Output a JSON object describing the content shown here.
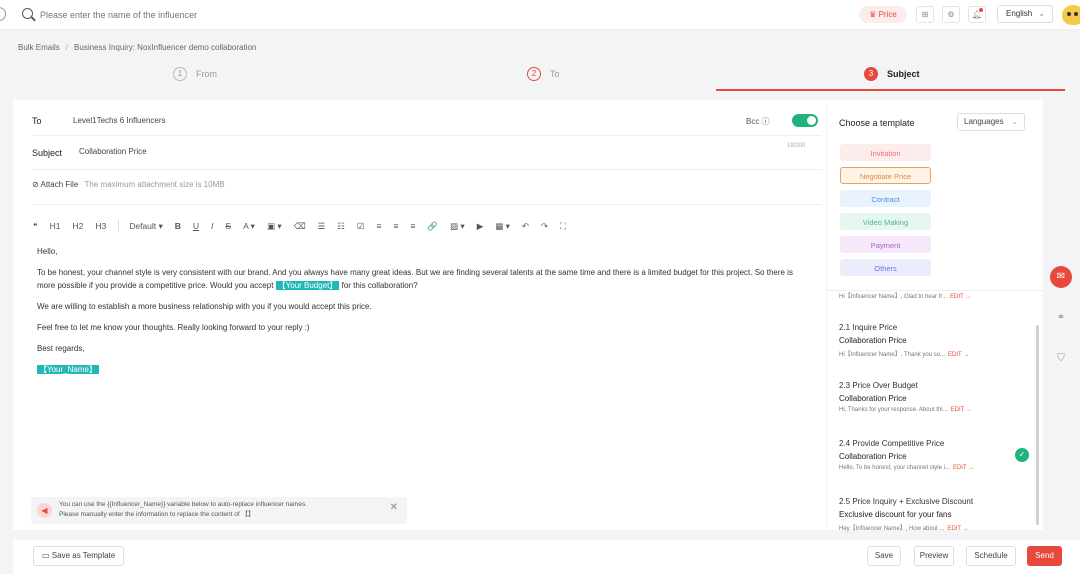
{
  "topbar": {
    "search_placeholder": "Please enter the name of the influencer",
    "price_label": "♛ Price",
    "language": "English"
  },
  "breadcrumb": {
    "root": "Bulk Emails",
    "current": "Business Inquiry: NoxInfluencer demo collaboration"
  },
  "steps": [
    {
      "num": "1",
      "label": "From"
    },
    {
      "num": "2",
      "label": "To"
    },
    {
      "num": "3",
      "label": "Subject"
    }
  ],
  "form": {
    "to_label": "To",
    "to_value": "Level1Techs 6 Influencers",
    "bcc_label": "Bcc ⓘ",
    "subject_label": "Subject",
    "subject_value": "Collaboration Price",
    "subject_counter": "19/200",
    "attach_label": "Attach File",
    "attach_hint": "The maximum attachment size is 10MB"
  },
  "toolbar": {
    "quote": "❝",
    "h1": "H1",
    "h2": "H2",
    "h3": "H3",
    "font": "Default ▾",
    "bold": "B",
    "underline": "U",
    "italic": "I",
    "strike": "S",
    "color": "A ▾",
    "bg": "▣ ▾",
    "eraser": "⌫",
    "ul": "☰",
    "ol": "☷",
    "task": "☑",
    "align_left": "≡",
    "align_center": "≡",
    "align_right": "≡",
    "link": "🔗",
    "image": "▨ ▾",
    "video": "▶",
    "table": "▦ ▾",
    "undo": "↶",
    "redo": "↷",
    "fullscreen": "⛶"
  },
  "body": {
    "greeting": "Hello,",
    "p1_a": "To be honest, your channel style is very consistent with our brand. And you always have many great ideas. But we are finding several talents at the same time and there is a limited budget for this project. So there is more possible if you provide a competitive price. Would you accept ",
    "p1_tag": "【Your Budget】",
    "p1_b": " for this collaboration?",
    "p2": "We are willing to establish a more business relationship with you if you would accept this price.",
    "p3": "Feel free to let me know your thoughts. Really looking forward to your reply :)",
    "p4": "Best regards,",
    "signature_tag": "【Your_Name】"
  },
  "hint": {
    "line1": "You can use the {{Influencer_Name}} variable below to auto-replace influencer names.",
    "line2": "Please manually enter the information to replace the content of 【】"
  },
  "template_panel": {
    "title": "Choose a template",
    "languages": "Languages",
    "categories": [
      {
        "label": "Invitation",
        "bg": "#fdecec",
        "color": "#e57373",
        "border": "#fdecec"
      },
      {
        "label": "Negotiate Price",
        "bg": "#fef3e6",
        "color": "#e08a3c",
        "border": "#e8a25c"
      },
      {
        "label": "Contract",
        "bg": "#e8f3fd",
        "color": "#4a90d9",
        "border": "#e8f3fd"
      },
      {
        "label": "Video Making",
        "bg": "#e6f7ef",
        "color": "#4cb88a",
        "border": "#e6f7ef"
      },
      {
        "label": "Payment",
        "bg": "#f6e8fb",
        "color": "#b05cc7",
        "border": "#f6e8fb"
      },
      {
        "label": "Others",
        "bg": "#ecedfc",
        "color": "#6b72d8",
        "border": "#ecedfc"
      }
    ],
    "partial_preview": "Hi【Influencer Name】, Glad to hear fr...",
    "edit_label": "EDIT →",
    "templates": [
      {
        "name": "2.1 Inquire Price",
        "subject": "Collaboration Price",
        "preview": "Hi【Influencer Name】, Thank you so..."
      },
      {
        "name": "2.3 Price Over Budget",
        "subject": "Collaboration Price",
        "preview": "Hi, Thanks for your response. About thi..."
      },
      {
        "name": "2.4 Provide Competitive Price",
        "subject": "Collaboration Price",
        "preview": "Hello, To be honest, your channel style i..."
      },
      {
        "name": "2.5 Price Inquiry + Exclusive Discount",
        "subject": "Exclusive discount for your fans",
        "preview": "Hey【Influencer Name】, How about ..."
      }
    ]
  },
  "footer": {
    "save_template": "Save as Template",
    "save": "Save",
    "preview": "Preview",
    "schedule": "Schedule",
    "send": "Send"
  }
}
